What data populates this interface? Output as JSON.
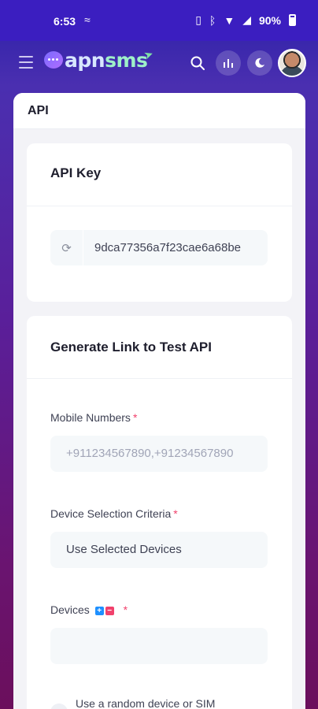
{
  "statusbar": {
    "time": "6:53",
    "battery": "90%"
  },
  "header": {
    "logo_prefix": "apn",
    "logo_suffix": "sms"
  },
  "panel": {
    "title": "API"
  },
  "api_key_card": {
    "title": "API Key",
    "key_value": "9dca77356a7f23cae6a68be"
  },
  "test_card": {
    "title": "Generate Link to Test API",
    "mobile_label": "Mobile Numbers",
    "mobile_placeholder": "+911234567890,+91234567890",
    "criteria_label": "Device Selection Criteria",
    "criteria_value": "Use Selected Devices",
    "devices_label": "Devices",
    "devices_value": "",
    "required_mark": "*",
    "random_label": "Use a random device or SIM"
  },
  "colors": {
    "brand": "#3b1ec0",
    "required": "#f1416c",
    "plus": "#1e90ff"
  }
}
